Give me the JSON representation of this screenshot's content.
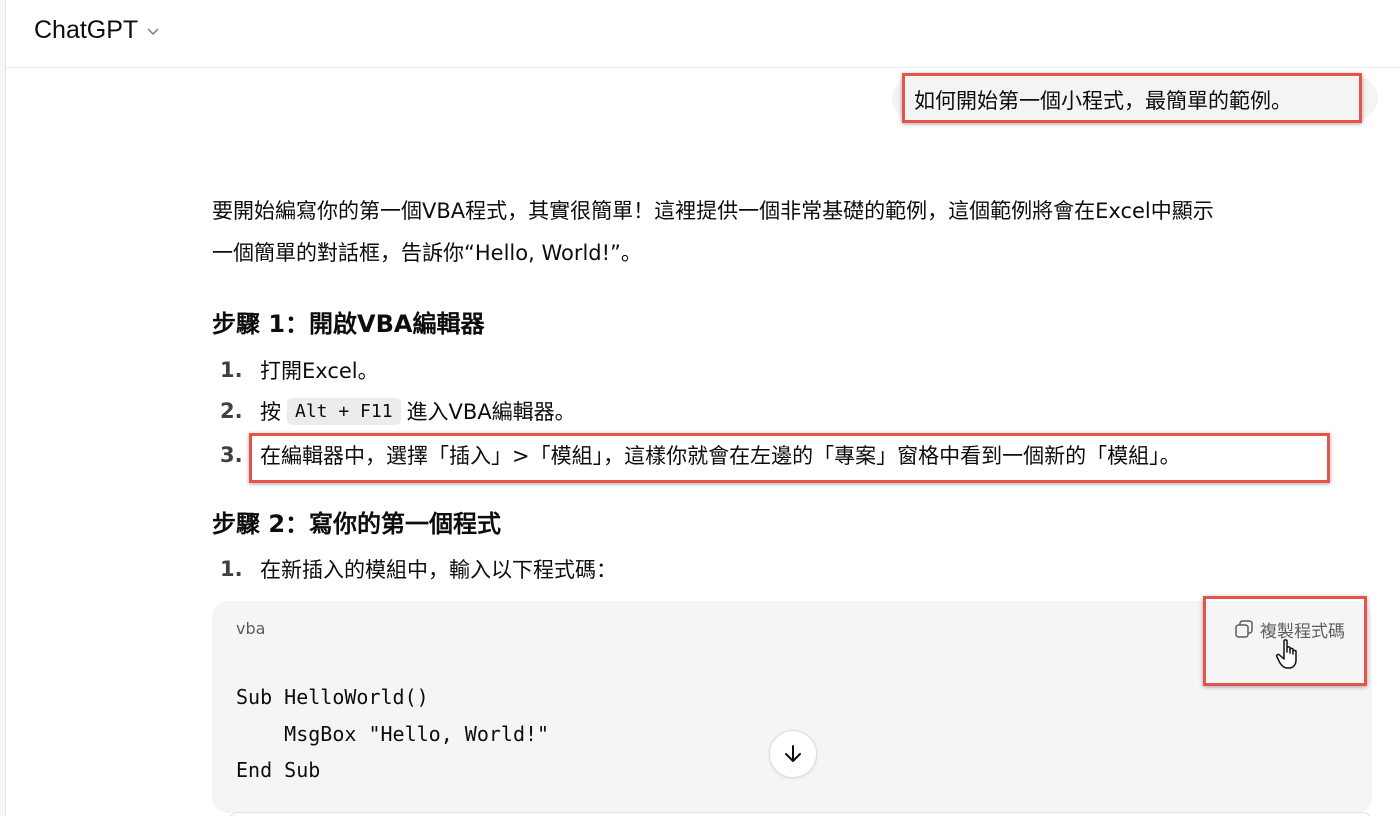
{
  "header": {
    "model_name": "ChatGPT",
    "chevron_icon": "chevron-down-icon"
  },
  "user_message": "如何開始第一個小程式，最簡單的範例。",
  "assistant": {
    "intro_line1": "要開始編寫你的第一個VBA程式，其實很簡單！這裡提供一個非常基礎的範例，這個範例將會在Excel中顯示",
    "intro_line2": "一個簡單的對話框，告訴你“Hello, World!”。",
    "step1": {
      "heading": "步驟 1：開啟VBA編輯器",
      "items": [
        {
          "num": "1.",
          "text": "打開Excel。"
        },
        {
          "num": "2.",
          "pre": "按",
          "kbd": "Alt + F11",
          "post": "進入VBA編輯器。"
        },
        {
          "num": "3.",
          "text": "在編輯器中，選擇「插入」>「模組」，這樣你就會在左邊的「專案」窗格中看到一個新的「模組」。"
        }
      ]
    },
    "step2": {
      "heading": "步驟 2：寫你的第一個程式",
      "items": [
        {
          "num": "1.",
          "text": "在新插入的模組中，輸入以下程式碼："
        }
      ]
    },
    "code_block": {
      "language": "vba",
      "copy_label": "複製程式碼",
      "copy_icon": "copy-icon",
      "lines": [
        "Sub HelloWorld()",
        "    MsgBox \"Hello, World!\"",
        "End Sub"
      ]
    }
  },
  "scroll_button_icon": "arrow-down-icon",
  "colors": {
    "highlight": "#e5544b",
    "code_bg": "#f5f5f5",
    "bubble_bg": "#f4f4f4"
  }
}
